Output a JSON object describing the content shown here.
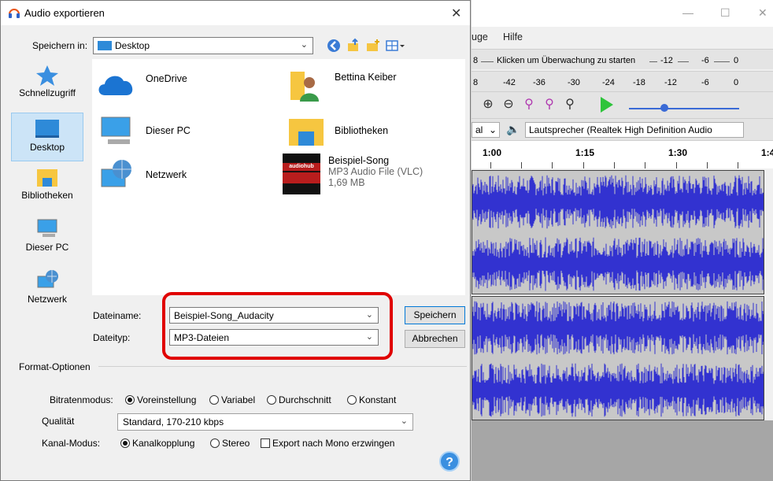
{
  "dialog": {
    "title": "Audio exportieren",
    "close_glyph": "✕",
    "save_in_label": "Speichern in:",
    "save_in_value": "Desktop",
    "places": [
      {
        "label": "Schnellzugriff",
        "icon": "star-icon"
      },
      {
        "label": "Desktop",
        "icon": "desktop-icon",
        "selected": true
      },
      {
        "label": "Bibliotheken",
        "icon": "folder-icon"
      },
      {
        "label": "Dieser PC",
        "icon": "computer-icon"
      },
      {
        "label": "Netzwerk",
        "icon": "network-icon"
      }
    ],
    "files": [
      {
        "name": "OneDrive",
        "icon": "cloud-icon"
      },
      {
        "name": "Bettina Keiber",
        "icon": "user-folder-icon"
      },
      {
        "name": "Dieser PC",
        "icon": "computer-icon"
      },
      {
        "name": "Bibliotheken",
        "icon": "folder-icon"
      },
      {
        "name": "Netzwerk",
        "icon": "network-icon"
      },
      {
        "name": "Beispiel-Song",
        "type": "MP3 Audio File (VLC)",
        "size": "1,69 MB",
        "thumb_text": "audiohub",
        "icon": "audio-file-icon"
      }
    ],
    "filename_label": "Dateiname:",
    "filename_value": "Beispiel-Song_Audacity",
    "filetype_label": "Dateityp:",
    "filetype_value": "MP3-Dateien",
    "save_button": "Speichern",
    "cancel_button": "Abbrechen",
    "format_options": {
      "heading": "Format-Optionen",
      "bitrate_label": "Bitratenmodus:",
      "bitrate_options": [
        "Voreinstellung",
        "Variabel",
        "Durchschnitt",
        "Konstant"
      ],
      "bitrate_selected": "Voreinstellung",
      "quality_label": "Qualität",
      "quality_value": "Standard, 170-210 kbps",
      "channel_label": "Kanal-Modus:",
      "channel_options": [
        "Kanalkopplung",
        "Stereo"
      ],
      "channel_selected": "Kanalkopplung",
      "mono_checkbox": "Export nach Mono erzwingen",
      "mono_checked": false,
      "help": "?"
    }
  },
  "audacity": {
    "window_buttons": [
      "—",
      "☐",
      "✕"
    ],
    "menu": [
      "uge",
      "Hilfe"
    ],
    "meter_record": {
      "left": "8",
      "hint": "Klicken um Überwachung zu starten",
      "ticks": [
        "-12",
        "-6",
        "0"
      ]
    },
    "meter_play": {
      "left": "8",
      "ticks": [
        "-42",
        "-36",
        "-30",
        "-24",
        "-18",
        "-12",
        "-6",
        "0"
      ]
    },
    "device_left": "al",
    "device_output": "Lautsprecher (Realtek High Definition Audio",
    "timeline": [
      "1:00",
      "1:15",
      "1:30",
      "1:4"
    ]
  },
  "colors": {
    "accent": "#0078d7",
    "highlight": "#e00000",
    "waveform": "#3232d0"
  }
}
